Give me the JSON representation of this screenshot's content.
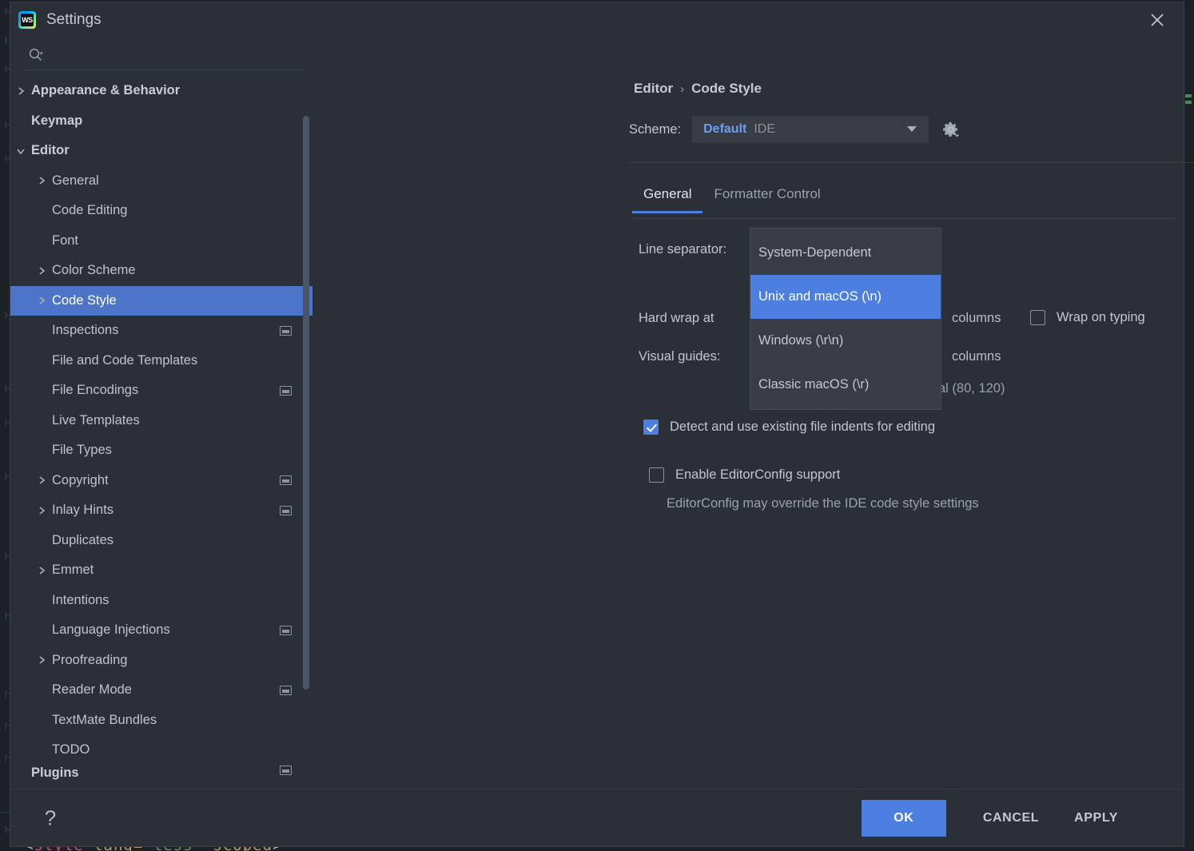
{
  "window": {
    "title": "Settings",
    "app_icon": "webstorm-logo",
    "close_icon": "close-icon"
  },
  "sidebar": {
    "search": {
      "placeholder": "",
      "value": "",
      "icon": "search-icon"
    },
    "items": [
      {
        "label": "Appearance & Behavior",
        "indent": 0,
        "arrow": "chevron-right",
        "bold": true,
        "chip": false,
        "selected": false
      },
      {
        "label": "Keymap",
        "indent": 0,
        "arrow": "",
        "bold": true,
        "chip": false,
        "selected": false
      },
      {
        "label": "Editor",
        "indent": 0,
        "arrow": "chevron-down",
        "bold": true,
        "chip": false,
        "selected": false
      },
      {
        "label": "General",
        "indent": 1,
        "arrow": "chevron-right",
        "bold": false,
        "chip": false,
        "selected": false
      },
      {
        "label": "Code Editing",
        "indent": 1,
        "arrow": "",
        "bold": false,
        "chip": false,
        "selected": false
      },
      {
        "label": "Font",
        "indent": 1,
        "arrow": "",
        "bold": false,
        "chip": false,
        "selected": false
      },
      {
        "label": "Color Scheme",
        "indent": 1,
        "arrow": "chevron-right",
        "bold": false,
        "chip": false,
        "selected": false
      },
      {
        "label": "Code Style",
        "indent": 1,
        "arrow": "chevron-right",
        "bold": false,
        "chip": false,
        "selected": true
      },
      {
        "label": "Inspections",
        "indent": 1,
        "arrow": "",
        "bold": false,
        "chip": true,
        "selected": false
      },
      {
        "label": "File and Code Templates",
        "indent": 1,
        "arrow": "",
        "bold": false,
        "chip": false,
        "selected": false
      },
      {
        "label": "File Encodings",
        "indent": 1,
        "arrow": "",
        "bold": false,
        "chip": true,
        "selected": false
      },
      {
        "label": "Live Templates",
        "indent": 1,
        "arrow": "",
        "bold": false,
        "chip": false,
        "selected": false
      },
      {
        "label": "File Types",
        "indent": 1,
        "arrow": "",
        "bold": false,
        "chip": false,
        "selected": false
      },
      {
        "label": "Copyright",
        "indent": 1,
        "arrow": "chevron-right",
        "bold": false,
        "chip": true,
        "selected": false
      },
      {
        "label": "Inlay Hints",
        "indent": 1,
        "arrow": "chevron-right",
        "bold": false,
        "chip": true,
        "selected": false
      },
      {
        "label": "Duplicates",
        "indent": 1,
        "arrow": "",
        "bold": false,
        "chip": false,
        "selected": false
      },
      {
        "label": "Emmet",
        "indent": 1,
        "arrow": "chevron-right",
        "bold": false,
        "chip": false,
        "selected": false
      },
      {
        "label": "Intentions",
        "indent": 1,
        "arrow": "",
        "bold": false,
        "chip": false,
        "selected": false
      },
      {
        "label": "Language Injections",
        "indent": 1,
        "arrow": "",
        "bold": false,
        "chip": true,
        "selected": false
      },
      {
        "label": "Proofreading",
        "indent": 1,
        "arrow": "chevron-right",
        "bold": false,
        "chip": false,
        "selected": false
      },
      {
        "label": "Reader Mode",
        "indent": 1,
        "arrow": "",
        "bold": false,
        "chip": true,
        "selected": false
      },
      {
        "label": "TextMate Bundles",
        "indent": 1,
        "arrow": "",
        "bold": false,
        "chip": false,
        "selected": false
      },
      {
        "label": "TODO",
        "indent": 1,
        "arrow": "",
        "bold": false,
        "chip": false,
        "selected": false
      },
      {
        "label": "Plugins",
        "indent": 0,
        "arrow": "",
        "bold": true,
        "chip": true,
        "selected": false
      }
    ]
  },
  "main": {
    "breadcrumb": {
      "parent": "Editor",
      "separator": "›",
      "current": "Code Style"
    },
    "scheme": {
      "label": "Scheme:",
      "value_primary": "Default",
      "value_secondary": "IDE",
      "arrow_icon": "chevron-down-icon",
      "gear_icon": "gear-icon"
    },
    "tabs": [
      {
        "label": "General",
        "active": true
      },
      {
        "label": "Formatter Control",
        "active": false
      }
    ],
    "fields": {
      "line_separator_label": "Line separator:",
      "line_separator_value": "System-Dependent",
      "hard_wrap_label": "Hard wrap at",
      "hard_wrap_columns_unit": "columns",
      "wrap_on_typing_label": "Wrap on typing",
      "wrap_on_typing_checked": false,
      "visual_guides_label": "Visual guides:",
      "visual_guides_columns_unit": "columns",
      "visual_guides_hint": "al (80, 120)"
    },
    "checkboxes": [
      {
        "label": "Detect and use existing file indents for editing",
        "checked": true
      },
      {
        "label": "Enable EditorConfig support",
        "checked": false
      }
    ],
    "editorconfig_hint": "EditorConfig may override the IDE code style settings"
  },
  "dropdown": {
    "open": true,
    "options": [
      {
        "label": "System-Dependent",
        "selected": false
      },
      {
        "label": "Unix and macOS (\\n)",
        "selected": true
      },
      {
        "label": "Windows (\\r\\n)",
        "selected": false
      },
      {
        "label": "Classic macOS (\\r)",
        "selected": false
      }
    ]
  },
  "footer": {
    "help_icon": "?",
    "ok_label": "OK",
    "cancel_label": "CANCEL",
    "apply_label": "APPLY"
  },
  "background": {
    "code_line": {
      "open": "<",
      "tag": "style",
      "attr": "lang=",
      "value": "less",
      "extra": "scoped",
      "close": ">"
    }
  },
  "colors": {
    "accent_blue": "#4c7fe0",
    "selection_blue": "#4c74c9",
    "dialog_bg": "#2b2f37",
    "panel_bg": "#1c2027",
    "field_bg": "#383c45",
    "text": "#c2c7cf",
    "muted_text": "#9aa1ab",
    "scheme_value": "#6d9ff0"
  }
}
